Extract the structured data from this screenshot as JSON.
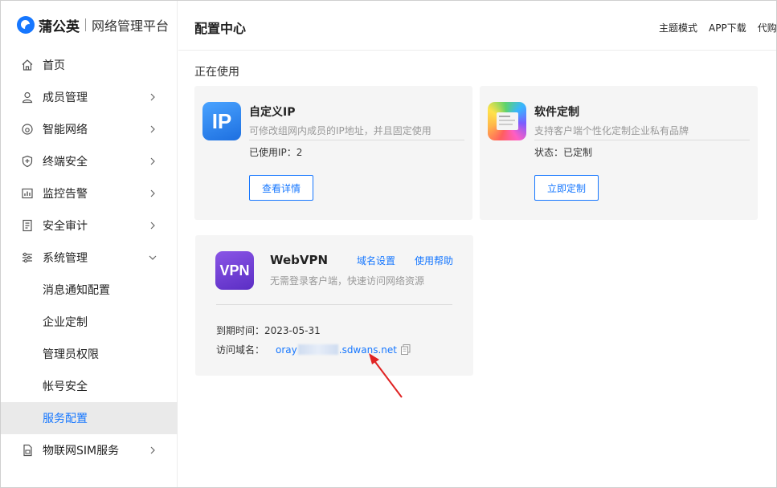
{
  "app": {
    "brand": "蒲公英",
    "subtitle": "网络管理平台"
  },
  "sidebar": {
    "items": [
      {
        "label": "首页",
        "icon": "home-icon",
        "has_chevron": false
      },
      {
        "label": "成员管理",
        "icon": "user-icon",
        "has_chevron": true
      },
      {
        "label": "智能网络",
        "icon": "network-icon",
        "has_chevron": true
      },
      {
        "label": "终端安全",
        "icon": "shield-icon",
        "has_chevron": true
      },
      {
        "label": "监控告警",
        "icon": "monitor-icon",
        "has_chevron": true
      },
      {
        "label": "安全审计",
        "icon": "audit-icon",
        "has_chevron": true
      },
      {
        "label": "系统管理",
        "icon": "settings-icon",
        "has_chevron": true,
        "expanded": true
      },
      {
        "label": "物联网SIM服务",
        "icon": "sim-icon",
        "has_chevron": true
      }
    ],
    "sub_items": [
      "消息通知配置",
      "企业定制",
      "管理员权限",
      "帐号安全",
      "服务配置"
    ],
    "active_sub_item": "服务配置"
  },
  "header": {
    "title": "配置中心",
    "links": [
      "主题模式",
      "APP下载",
      "代购"
    ]
  },
  "main": {
    "section_label": "正在使用",
    "cards": {
      "custom_ip": {
        "icon_text": "IP",
        "title": "自定义IP",
        "desc": "可修改组网内成员的IP地址，并且固定使用",
        "info": "已使用IP：2",
        "button": "查看详情"
      },
      "software": {
        "title": "软件定制",
        "desc": "支持客户端个性化定制企业私有品牌",
        "info": "状态：已定制",
        "button": "立即定制"
      },
      "webvpn": {
        "icon_text": "VPN",
        "title": "WebVPN",
        "link_domain": "域名设置",
        "link_help": "使用帮助",
        "desc": "无需登录客户端，快速访问网络资源",
        "expiry_label": "到期时间：",
        "expiry_value": "2023-05-31",
        "domain_label": "访问域名：",
        "domain_prefix": "oray",
        "domain_suffix": ".sdwans.net"
      }
    }
  },
  "colors": {
    "accent": "#1677ff",
    "annotation": "#e02424",
    "card_bg": "#f5f5f5",
    "active_bg": "#eaeaea"
  }
}
